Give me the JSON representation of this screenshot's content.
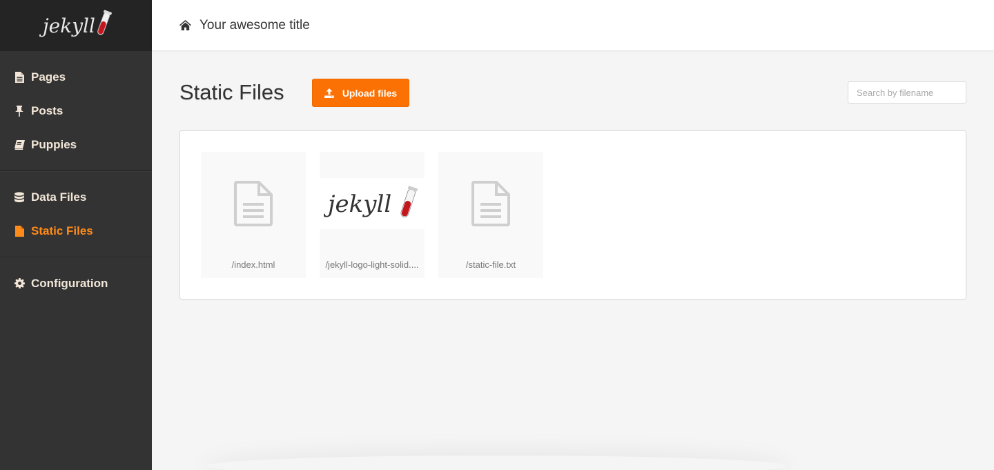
{
  "sidebar": {
    "logo_text": "jekyll",
    "groups": [
      {
        "items": [
          {
            "label": "Pages",
            "icon": "file-text-icon"
          },
          {
            "label": "Posts",
            "icon": "thumbtack-icon"
          },
          {
            "label": "Puppies",
            "icon": "book-icon"
          }
        ]
      },
      {
        "items": [
          {
            "label": "Data Files",
            "icon": "database-icon"
          },
          {
            "label": "Static Files",
            "icon": "file-icon",
            "active": true
          }
        ]
      },
      {
        "items": [
          {
            "label": "Configuration",
            "icon": "gear-icon"
          }
        ]
      }
    ]
  },
  "topbar": {
    "title": "Your awesome title",
    "icon": "home-icon"
  },
  "main": {
    "title": "Static Files",
    "upload_label": "Upload files",
    "search": {
      "placeholder": "Search by filename",
      "value": ""
    },
    "files": [
      {
        "name": "/index.html",
        "type": "document"
      },
      {
        "name": "/jekyll-logo-light-solid....",
        "type": "image"
      },
      {
        "name": "/static-file.txt",
        "type": "document"
      }
    ]
  },
  "colors": {
    "accent": "#fc7103",
    "sidebar_bg": "#333333",
    "sidebar_text": "#f2e6d8",
    "active": "#ff8c1a"
  }
}
